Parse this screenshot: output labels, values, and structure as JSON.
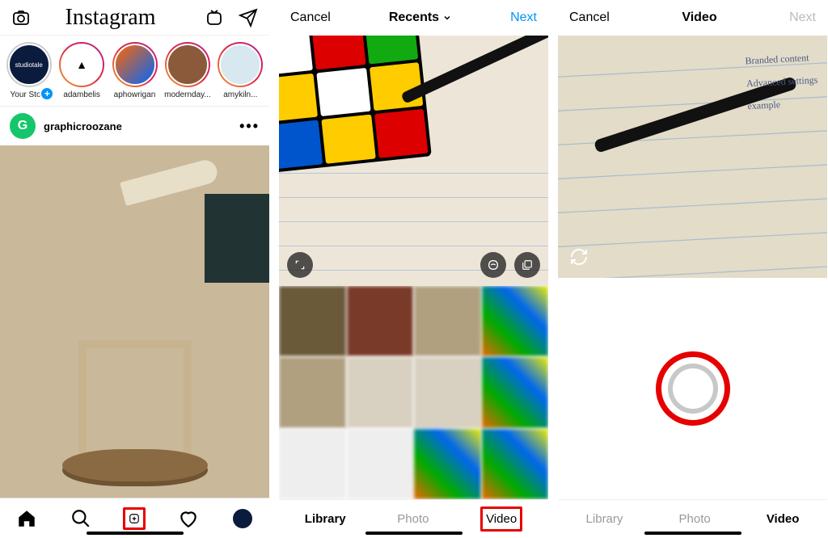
{
  "screen1": {
    "app_title": "Instagram",
    "stories": [
      {
        "label": "Your Story",
        "own": true,
        "avatar_text": "studiotale"
      },
      {
        "label": "adambelis"
      },
      {
        "label": "aphowrigan"
      },
      {
        "label": "modernday..."
      },
      {
        "label": "amykiln..."
      }
    ],
    "post": {
      "username": "graphicroozane",
      "avatar_initial": "G",
      "more": "•••"
    },
    "icons": {
      "camera": "camera-icon",
      "igtv": "igtv-icon",
      "messenger": "send-icon",
      "home": "home-icon",
      "search": "search-icon",
      "add": "add-post-icon",
      "heart": "heart-icon",
      "profile": "profile-avatar"
    }
  },
  "screen2": {
    "cancel": "Cancel",
    "title": "Recents",
    "next": "Next",
    "tabs": {
      "library": "Library",
      "photo": "Photo",
      "video": "Video",
      "active": "library",
      "highlighted": "video"
    }
  },
  "screen3": {
    "cancel": "Cancel",
    "title": "Video",
    "next": "Next",
    "tabs": {
      "library": "Library",
      "photo": "Photo",
      "video": "Video",
      "active": "video"
    }
  }
}
